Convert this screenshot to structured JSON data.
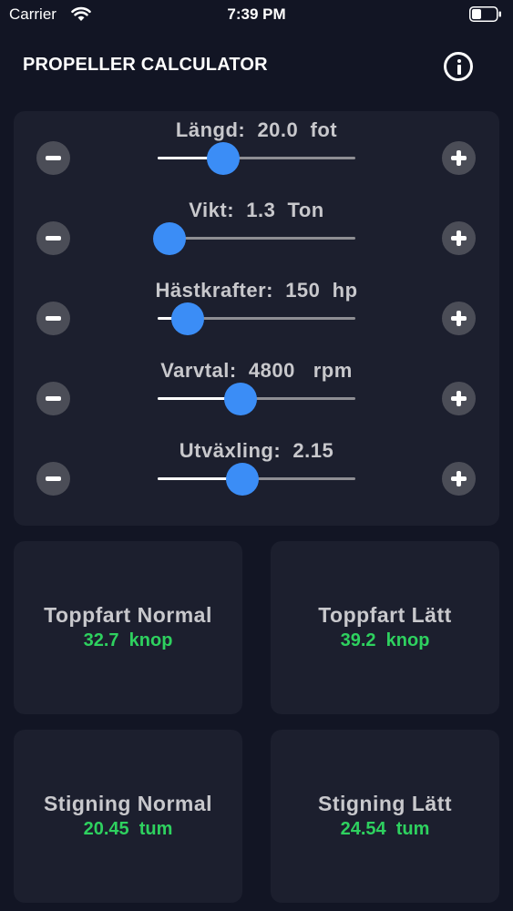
{
  "status_bar": {
    "carrier": "Carrier",
    "time": "7:39 PM"
  },
  "header": {
    "title": "PROPELLER CALCULATOR",
    "info_icon": "info-circle-icon"
  },
  "controls": [
    {
      "id": "length",
      "label": "Längd:  20.0  fot",
      "level": 0.33
    },
    {
      "id": "weight",
      "label": "Vikt:  1.3  Ton",
      "level": 0.06
    },
    {
      "id": "horsepower",
      "label": "Hästkrafter:  150  hp",
      "level": 0.15
    },
    {
      "id": "rpm",
      "label": "Varvtal:  4800   rpm",
      "level": 0.42
    },
    {
      "id": "gear",
      "label": "Utväxling:  2.15",
      "level": 0.43
    }
  ],
  "results": [
    {
      "id": "topspeed-normal",
      "title": "Toppfart Normal",
      "value": "32.7  knop"
    },
    {
      "id": "topspeed-light",
      "title": "Toppfart Lätt",
      "value": "39.2  knop"
    },
    {
      "id": "pitch-normal",
      "title": "Stigning Normal",
      "value": "20.45  tum"
    },
    {
      "id": "pitch-light",
      "title": "Stigning Lätt",
      "value": "24.54  tum"
    }
  ],
  "colors": {
    "background": "#121524",
    "card": "#1c1f2e",
    "accent": "#3b8df6",
    "result_value": "#2ed15f"
  }
}
